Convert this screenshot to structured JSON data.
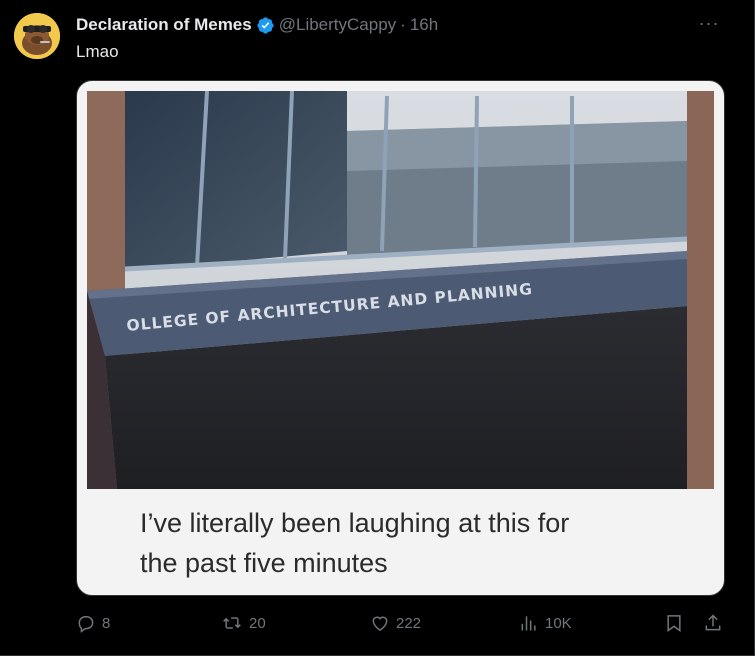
{
  "tweet": {
    "display_name": "Declaration of Memes",
    "handle": "@LibertyCappy",
    "separator": "·",
    "time": "16h",
    "more_label": "···",
    "text": "Lmao"
  },
  "media": {
    "sign_text": "OLLEGE OF ARCHITECTURE AND PLANNING",
    "caption_line1": "I’ve literally been laughing at this for",
    "caption_line2": "the past five minutes"
  },
  "actions": {
    "replies": "8",
    "reposts": "20",
    "likes": "222",
    "views": "10K"
  },
  "colors": {
    "background": "#000000",
    "text_primary": "#e7e9ea",
    "text_secondary": "#71767b",
    "verified": "#1d9bf0",
    "border": "#2f3336"
  },
  "icons": [
    "avatar-capybara",
    "verified-badge-icon",
    "more-icon",
    "reply-icon",
    "repost-icon",
    "like-icon",
    "views-icon",
    "bookmark-icon",
    "share-icon"
  ]
}
